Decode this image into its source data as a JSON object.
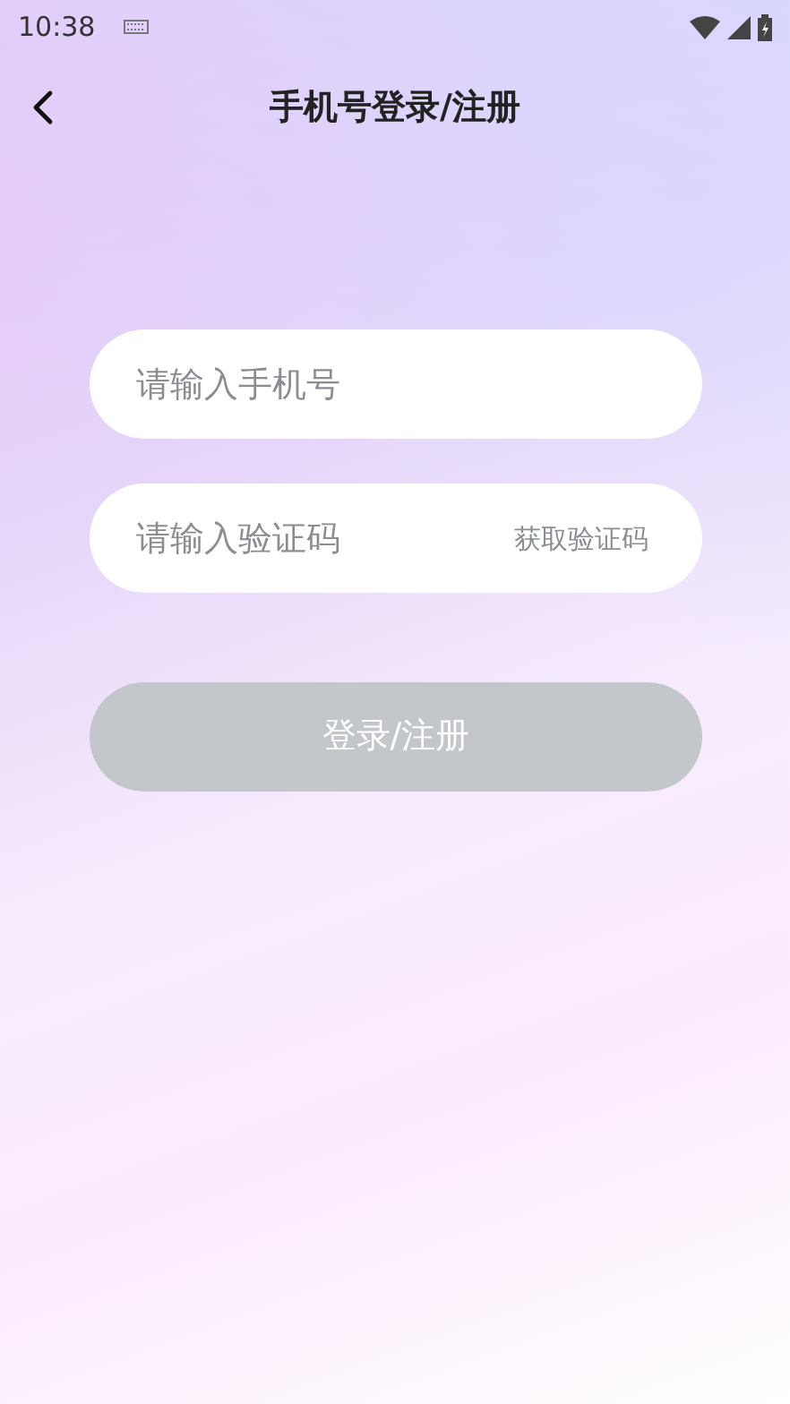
{
  "status_bar": {
    "time": "10:38"
  },
  "header": {
    "title": "手机号登录/注册"
  },
  "phone_field": {
    "placeholder": "请输入手机号"
  },
  "code_field": {
    "placeholder": "请输入验证码",
    "action": "获取验证码"
  },
  "login_button": {
    "label": "登录/注册",
    "disabled": true
  }
}
